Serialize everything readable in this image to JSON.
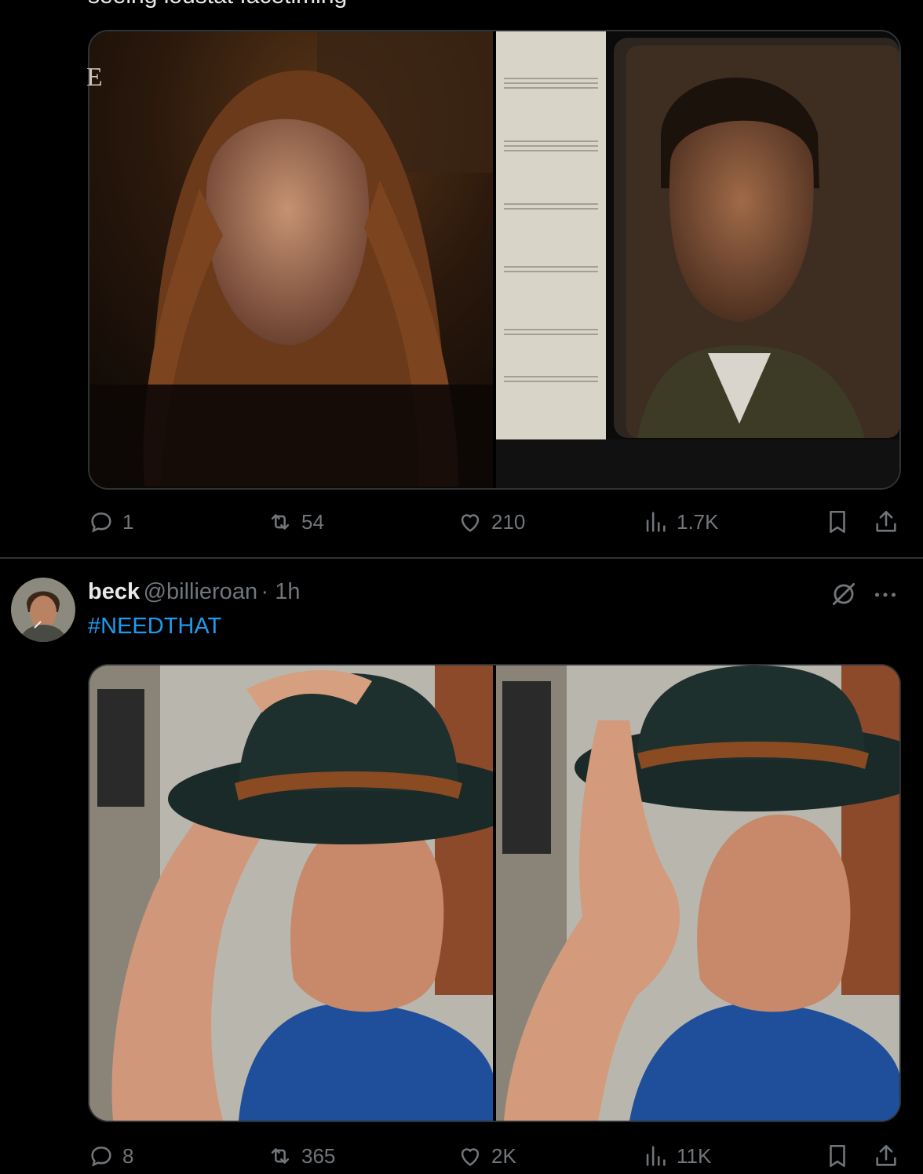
{
  "tweet1": {
    "text_cutoff": "seeing loustat facetiming",
    "media_overlay": "E",
    "stats": {
      "replies": "1",
      "retweets": "54",
      "likes": "210",
      "views": "1.7K"
    }
  },
  "tweet2": {
    "author_name": "beck",
    "author_handle": "@billieroan",
    "time": "· 1h",
    "hashtag": "#NEEDTHAT",
    "stats": {
      "replies": "8",
      "retweets": "365",
      "likes": "2K",
      "views": "11K"
    }
  },
  "icons": {
    "reply": "reply-icon",
    "retweet": "retweet-icon",
    "like": "heart-icon",
    "views": "views-icon",
    "bookmark": "bookmark-icon",
    "share": "share-icon",
    "grok": "grok-icon",
    "more": "more-icon"
  },
  "colors": {
    "background": "#000000",
    "text": "#e7e9ea",
    "muted": "#71767b",
    "link": "#1d9bf0",
    "border": "#2f3336"
  }
}
